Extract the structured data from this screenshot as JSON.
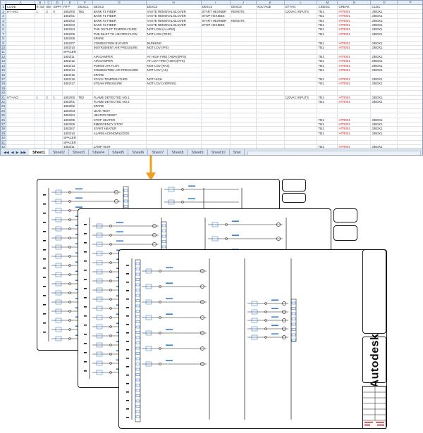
{
  "spreadsheet": {
    "columns": [
      "A",
      "B",
      "C",
      "D",
      "E",
      "F",
      "G",
      "H",
      "I",
      "J",
      "K",
      "L",
      "M",
      "N",
      "O",
      "P"
    ],
    "header_row": [
      "CODE",
      "RI S2",
      "SEI",
      "IOPPI",
      "RTP",
      "DESC1",
      "DESC2",
      "DESC3",
      "DESC4",
      "DESC5",
      "VOLTAGE",
      "DTYAG",
      "CIDESC",
      "CREAK",
      "CLDC"
    ],
    "rows": [
      {
        "n": "1",
        "a": "CODE",
        "b": "RI S2",
        "c": "SEI",
        "d": "IOPPI",
        "e": "RTP",
        "f": "DESC1",
        "g": "DESC2",
        "h": "DESC3",
        "i": "DESC4",
        "j": "DESC5",
        "k": "VOLTAGE",
        "l": "DTYAG",
        "m": "CIDESC",
        "n2": "CREAK",
        "o": "CLDC",
        "red": false
      },
      {
        "n": "2",
        "a": "IYT-IAO",
        "b": "1",
        "c": "2",
        "d": "0",
        "e": "1802/00",
        "f": "TB1",
        "g": "BANK #1 FIBER",
        "h": "VASTE REMOVAL BLOVER",
        "i": "START HEXNIBR",
        "j": "REMOTE",
        "k": "",
        "l": "120VAC INPUTS",
        "m": "TB1",
        "n2": "HTR001",
        "o": "J/BOX1",
        "red": true
      },
      {
        "n": "3",
        "a": "",
        "b": "",
        "c": "",
        "d": "",
        "e": "1802/01",
        "f": "",
        "g": "BANK #1 FIBER",
        "h": "VASTE REMOVAL BLOVER",
        "i": "STOP HEXIBBS",
        "j": "",
        "k": "",
        "l": "",
        "m": "TB1",
        "n2": "HTR001",
        "o": "J/BOX1",
        "red": true
      },
      {
        "n": "4",
        "a": "",
        "b": "",
        "c": "",
        "d": "",
        "e": "1802/02",
        "f": "",
        "g": "BANK #2 FIBER",
        "h": "VASTE REMOVAL BLOVER",
        "i": "START HEXNIBR",
        "j": "REMOTE",
        "k": "",
        "l": "",
        "m": "TB1",
        "n2": "HTR001",
        "o": "J/BOX1",
        "red": true
      },
      {
        "n": "5",
        "a": "",
        "b": "",
        "c": "",
        "d": "",
        "e": "1802/03",
        "f": "",
        "g": "BANK #2 FIBER",
        "h": "VASTE REMOVAL BLOVER",
        "i": "STOP HEXIBBS",
        "j": "",
        "k": "",
        "l": "",
        "m": "TB1",
        "n2": "HTR001",
        "o": "J/BOX1",
        "red": true
      },
      {
        "n": "6",
        "a": "",
        "b": "",
        "c": "",
        "d": "",
        "e": "1802/04",
        "f": "",
        "g": "TUB OUTLET TEMPERATURE",
        "h": "NOT LOW (ALARM)",
        "i": "",
        "j": "",
        "k": "",
        "l": "",
        "m": "TB1",
        "n2": "HTR001",
        "o": "J/BOX1",
        "red": true
      },
      {
        "n": "7",
        "a": "",
        "b": "",
        "c": "",
        "d": "",
        "e": "1802/05",
        "f": "",
        "g": "TUB INLET TO HEATER FLOW",
        "h": "NOT LOW (TRIP)",
        "i": "",
        "j": "",
        "k": "",
        "l": "",
        "m": "TB1",
        "n2": "HTR001",
        "o": "J/BOX1",
        "red": true
      },
      {
        "n": "8",
        "a": "",
        "b": "",
        "c": "",
        "d": "",
        "e": "1802/06",
        "f": "",
        "g": "SPARE",
        "h": "",
        "i": "",
        "j": "",
        "k": "",
        "l": "",
        "m": "",
        "n2": "",
        "o": "",
        "red": false
      },
      {
        "n": "9",
        "a": "",
        "b": "",
        "c": "",
        "d": "",
        "e": "1802/07",
        "f": "",
        "g": "COMBUSTION BLOVER",
        "h": "RUNNING",
        "i": "",
        "j": "",
        "k": "",
        "l": "",
        "m": "TB1",
        "n2": "HTR001",
        "o": "J/BOX1",
        "red": true
      },
      {
        "n": "10",
        "a": "",
        "b": "",
        "c": "",
        "d": "",
        "e": "1802/10",
        "f": "",
        "g": "INSTRUMENT AIR PRESSURE",
        "h": "NOT LOV (IPS)",
        "i": "",
        "j": "",
        "k": "",
        "l": "",
        "m": "TB1",
        "n2": "HTR001",
        "o": "J/BOX1",
        "red": true
      },
      {
        "n": "11",
        "a": "",
        "b": "",
        "c": "",
        "d": "",
        "e": "SPACER",
        "f": "",
        "g": "",
        "h": "",
        "i": "",
        "j": "",
        "k": "",
        "l": "",
        "m": "",
        "n2": "",
        "o": "",
        "red": false
      },
      {
        "n": "12",
        "a": "",
        "b": "",
        "c": "",
        "d": "",
        "e": "1802/11",
        "f": "",
        "g": "AIR DAMPER",
        "h": "AT HIGH FIRE (>80%)(PFS)",
        "i": "",
        "j": "",
        "k": "",
        "l": "",
        "m": "TB1",
        "n2": "HTR001",
        "o": "J/BOX1",
        "red": true
      },
      {
        "n": "13",
        "a": "",
        "b": "",
        "c": "",
        "d": "",
        "e": "1802/12",
        "f": "",
        "g": "AIR DAMPER",
        "h": "AT LOV FIRE (<20%)(PFS)",
        "i": "",
        "j": "",
        "k": "",
        "l": "",
        "m": "TB1",
        "n2": "HTR001",
        "o": "J/BOX1",
        "red": true
      },
      {
        "n": "14",
        "a": "",
        "b": "",
        "c": "",
        "d": "",
        "e": "1802/13",
        "f": "",
        "g": "PURGE AIR FLOV",
        "h": "NOT LOV (PAS)",
        "i": "",
        "j": "",
        "k": "",
        "l": "",
        "m": "TB1",
        "n2": "HTR001",
        "o": "J/BOX1",
        "red": true
      },
      {
        "n": "15",
        "a": "",
        "b": "",
        "c": "",
        "d": "",
        "e": "1802/14",
        "f": "",
        "g": "COMBUSTION AIR PRESSURE",
        "h": "NOT LOV (AS)",
        "i": "",
        "j": "",
        "k": "",
        "l": "",
        "m": "TB1",
        "n2": "HTR001",
        "o": "J/BOX1",
        "red": true
      },
      {
        "n": "16",
        "a": "",
        "b": "",
        "c": "",
        "d": "",
        "e": "1802/15",
        "f": "",
        "g": "SPARE",
        "h": "",
        "i": "",
        "j": "",
        "k": "",
        "l": "",
        "m": "",
        "n2": "",
        "o": "",
        "red": false
      },
      {
        "n": "17",
        "a": "",
        "b": "",
        "c": "",
        "d": "",
        "e": "1802/16",
        "f": "",
        "g": "STACK TEMPERATURE",
        "h": "NOT HIGH",
        "i": "",
        "j": "",
        "k": "",
        "l": "",
        "m": "TB1",
        "n2": "HTR001",
        "o": "J/BOX1",
        "red": true
      },
      {
        "n": "18",
        "a": "",
        "b": "",
        "c": "",
        "d": "",
        "e": "1802/17",
        "f": "",
        "g": "STEAM PRESSURE",
        "h": "NOT LOV (>30PSIG)",
        "i": "",
        "j": "",
        "k": "",
        "l": "",
        "m": "TB1",
        "n2": "HTR001",
        "o": "J/BOX1",
        "red": true
      },
      {
        "n": "19",
        "a": "",
        "b": "",
        "c": "",
        "d": "",
        "e": "",
        "f": "",
        "g": "",
        "h": "",
        "i": "",
        "j": "",
        "k": "",
        "l": "",
        "m": "",
        "n2": "",
        "o": "",
        "red": false
      },
      {
        "n": "20",
        "a": "",
        "b": "",
        "c": "",
        "d": "",
        "e": "",
        "f": "",
        "g": "",
        "h": "",
        "i": "",
        "j": "",
        "k": "",
        "l": "",
        "m": "",
        "n2": "",
        "o": "",
        "red": false
      },
      {
        "n": "21",
        "a": "IYT-IAO",
        "b": "1",
        "c": "2",
        "d": "1",
        "e": "1803/00",
        "f": "TB2",
        "g": "FLAME DETECTED NO.1",
        "h": "",
        "i": "",
        "j": "",
        "k": "",
        "l": "120VAC INPUTS",
        "m": "TB1",
        "n2": "HTR001",
        "o": "J/BOX1",
        "red": true
      },
      {
        "n": "22",
        "a": "",
        "b": "",
        "c": "",
        "d": "",
        "e": "1803/01",
        "f": "",
        "g": "FLAME DETECTED NO.2",
        "h": "",
        "i": "",
        "j": "",
        "k": "",
        "l": "",
        "m": "TB1",
        "n2": "HTR001",
        "o": "J/BOX1",
        "red": true
      },
      {
        "n": "23",
        "a": "",
        "b": "",
        "c": "",
        "d": "",
        "e": "1803/02",
        "f": "",
        "g": "SPARE",
        "h": "",
        "i": "",
        "j": "",
        "k": "",
        "l": "",
        "m": "",
        "n2": "",
        "o": "",
        "red": false
      },
      {
        "n": "24",
        "a": "",
        "b": "",
        "c": "",
        "d": "",
        "e": "1803/03",
        "f": "",
        "g": "LEAK TEST",
        "h": "",
        "i": "",
        "j": "",
        "k": "",
        "l": "",
        "m": "",
        "n2": "",
        "o": "",
        "red": false
      },
      {
        "n": "25",
        "a": "",
        "b": "",
        "c": "",
        "d": "",
        "e": "1803/04",
        "f": "",
        "g": "HEATER RESET",
        "h": "",
        "i": "",
        "j": "",
        "k": "",
        "l": "",
        "m": "",
        "n2": "",
        "o": "",
        "red": false
      },
      {
        "n": "26",
        "a": "",
        "b": "",
        "c": "",
        "d": "",
        "e": "1803/05",
        "f": "",
        "g": "STOP HEATER",
        "h": "",
        "i": "",
        "j": "",
        "k": "",
        "l": "",
        "m": "TB1",
        "n2": "HTR001",
        "o": "J/BOX1",
        "red": true
      },
      {
        "n": "27",
        "a": "",
        "b": "",
        "c": "",
        "d": "",
        "e": "1803/06",
        "f": "",
        "g": "EMERGENCY STOP",
        "h": "",
        "i": "",
        "j": "",
        "k": "",
        "l": "",
        "m": "TB1",
        "n2": "HTR001",
        "o": "J/BOX1",
        "red": true
      },
      {
        "n": "28",
        "a": "",
        "b": "",
        "c": "",
        "d": "",
        "e": "1803/07",
        "f": "",
        "g": "START HEATER",
        "h": "",
        "i": "",
        "j": "",
        "k": "",
        "l": "",
        "m": "TB1",
        "n2": "HTR001",
        "o": "J/BOX1",
        "red": true
      },
      {
        "n": "29",
        "a": "",
        "b": "",
        "c": "",
        "d": "",
        "e": "1803/10",
        "f": "",
        "g": "ALARM ACKNOWLEDGE",
        "h": "",
        "i": "",
        "j": "",
        "k": "",
        "l": "",
        "m": "TB1",
        "n2": "HTR001",
        "o": "J/BOX1",
        "red": true
      },
      {
        "n": "30",
        "a": "",
        "b": "",
        "c": "",
        "d": "",
        "e": "SPACER",
        "f": "",
        "g": "",
        "h": "",
        "i": "",
        "j": "",
        "k": "",
        "l": "",
        "m": "",
        "n2": "",
        "o": "",
        "red": false
      },
      {
        "n": "31",
        "a": "",
        "b": "",
        "c": "",
        "d": "",
        "e": "SPACER",
        "f": "",
        "g": "",
        "h": "",
        "i": "",
        "j": "",
        "k": "",
        "l": "",
        "m": "",
        "n2": "",
        "o": "",
        "red": false
      },
      {
        "n": "32",
        "a": "",
        "b": "",
        "c": "",
        "d": "",
        "e": "1803/11",
        "f": "",
        "g": "LAMP TEST",
        "h": "",
        "i": "",
        "j": "",
        "k": "",
        "l": "",
        "m": "TB1",
        "n2": "HTR001",
        "o": "J/BOX1",
        "red": true
      },
      {
        "n": "33",
        "a": "",
        "b": "",
        "c": "",
        "d": "",
        "e": "1803/12",
        "f": "",
        "g": "V-STCHDOG OPERATING",
        "h": "",
        "i": "",
        "j": "",
        "k": "",
        "l": "",
        "m": "TB1",
        "n2": "HTR001",
        "o": "J/BOX1",
        "red": true
      },
      {
        "n": "34",
        "a": "",
        "b": "",
        "c": "",
        "d": "",
        "e": "1803/13",
        "f": "",
        "g": "SPARE",
        "h": "",
        "i": "",
        "j": "",
        "k": "",
        "l": "",
        "m": "",
        "n2": "",
        "o": "",
        "red": false
      }
    ],
    "tabs": [
      "Sheet1",
      "Sheet2",
      "Sheet3",
      "Sheet4",
      "Sheet5",
      "Sheet6",
      "Sheet7",
      "Sheet8",
      "Sheet9",
      "Sheet10",
      "Shel"
    ],
    "active_tab": "Sheet1",
    "red_color": "#d22020"
  },
  "arrow": {
    "color": "#f0a020"
  },
  "drawings": {
    "line_color": "#1a1a1a",
    "annotation_color": "#1a6fd8",
    "logo_text": "Autodesk"
  }
}
